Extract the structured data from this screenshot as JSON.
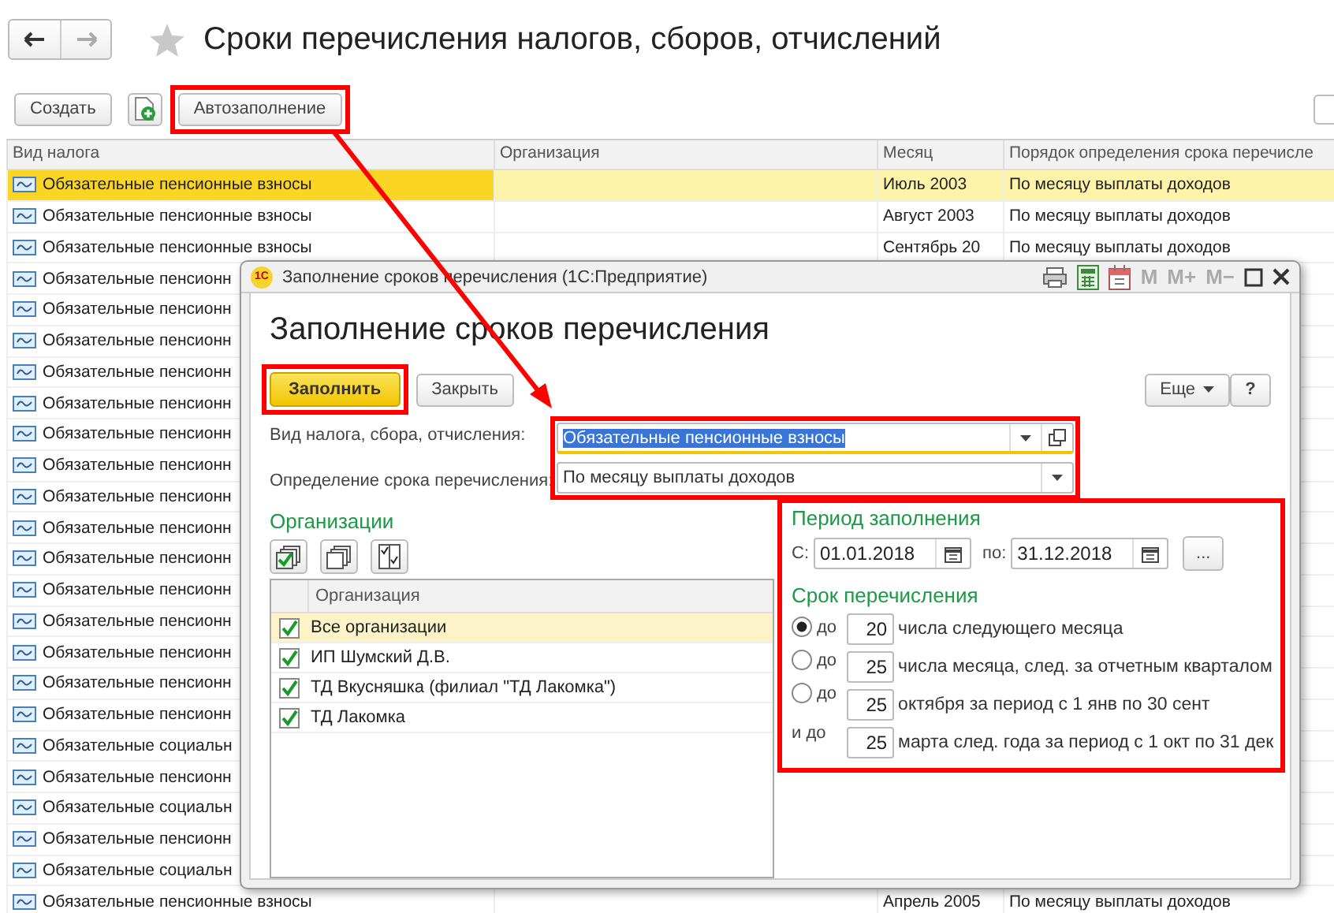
{
  "page_title": "Сроки перечисления налогов, сборов, отчислений",
  "toolbar": [
    {
      "kind": "text",
      "label": "Создать",
      "annotated": false
    },
    {
      "kind": "add-icon",
      "annotated": false
    },
    {
      "kind": "text",
      "label": "Автозаполнение",
      "annotated": true
    }
  ],
  "table": {
    "columns": [
      "Вид налога",
      "Организация",
      "Месяц",
      "Порядок определения срока перечисле"
    ],
    "rows": [
      {
        "tax": "Обязательные пенсионные взносы",
        "organization": "",
        "month": "Июль 2003",
        "order": "По месяцу выплаты доходов",
        "selected": true
      },
      {
        "tax": "Обязательные пенсионные взносы",
        "organization": "",
        "month": "Август 2003",
        "order": "По месяцу выплаты доходов",
        "selected": false
      },
      {
        "tax": "Обязательные пенсионные взносы",
        "organization": "",
        "month": "Сентябрь 20",
        "order": "По месяцу выплаты доходов",
        "selected": false
      },
      {
        "tax": "Обязательные пенсионн",
        "selected": false
      },
      {
        "tax": "Обязательные пенсионн",
        "selected": false
      },
      {
        "tax": "Обязательные пенсионн",
        "selected": false
      },
      {
        "tax": "Обязательные пенсионн",
        "selected": false
      },
      {
        "tax": "Обязательные пенсионн",
        "selected": false
      },
      {
        "tax": "Обязательные пенсионн",
        "selected": false
      },
      {
        "tax": "Обязательные пенсионн",
        "selected": false
      },
      {
        "tax": "Обязательные пенсионн",
        "selected": false
      },
      {
        "tax": "Обязательные пенсионн",
        "selected": false
      },
      {
        "tax": "Обязательные пенсионн",
        "selected": false
      },
      {
        "tax": "Обязательные пенсионн",
        "selected": false
      },
      {
        "tax": "Обязательные пенсионн",
        "selected": false
      },
      {
        "tax": "Обязательные пенсионн",
        "selected": false
      },
      {
        "tax": "Обязательные пенсионн",
        "selected": false
      },
      {
        "tax": "Обязательные пенсионн",
        "selected": false
      },
      {
        "tax": "Обязательные социальн",
        "selected": false
      },
      {
        "tax": "Обязательные пенсионн",
        "selected": false
      },
      {
        "tax": "Обязательные социальн",
        "selected": false
      },
      {
        "tax": "Обязательные пенсионн",
        "selected": false
      },
      {
        "tax": "Обязательные социальн",
        "selected": false
      },
      {
        "tax": "Обязательные пенсионные взносы",
        "organization": "",
        "month": "Апрель 2005",
        "order": "По месяцу выплаты доходов",
        "selected": false
      }
    ]
  },
  "dialog": {
    "window_title": "Заполнение сроков перечисления  (1С:Предприятие)",
    "logo": "1С",
    "memory_buttons": [
      "M",
      "M+",
      "M−"
    ],
    "heading": "Заполнение сроков перечисления",
    "buttons": [
      {
        "kind": "default",
        "label": "Заполнить",
        "annotated": true
      },
      {
        "kind": "plain",
        "label": "Закрыть",
        "annotated": false
      }
    ],
    "more_button": "Еще",
    "help_button": "?",
    "fields_annotated": true,
    "fields": [
      {
        "label": "Вид налога, сбора, отчисления:",
        "value": "Обязательные пенсионные взносы",
        "text_selected": true,
        "open_button": true
      },
      {
        "label": "Определение срока перечисления:",
        "value": "По месяцу выплаты доходов",
        "text_selected": false,
        "open_button": false
      }
    ],
    "organizations": {
      "title": "Организации",
      "column": "Организация",
      "rows": [
        {
          "name": "Все организации",
          "checked": true,
          "selected": true
        },
        {
          "name": "ИП Шумский Д.В.",
          "checked": true,
          "selected": false
        },
        {
          "name": "ТД Вкусняшка (филиал \"ТД Лакомка\")",
          "checked": true,
          "selected": false
        },
        {
          "name": "ТД Лакомка",
          "checked": true,
          "selected": false
        }
      ]
    },
    "settings_annotated": true,
    "period": {
      "title": "Период заполнения",
      "from_label": "С:",
      "from": "01.01.2018",
      "to_label": "по:",
      "to": "31.12.2018",
      "choose_button": "..."
    },
    "deadline": {
      "title": "Срок перечисления",
      "options": [
        {
          "kind": "radio",
          "label": "до",
          "selected": true
        },
        {
          "kind": "radio",
          "label": "до",
          "selected": false
        },
        {
          "kind": "radio",
          "label": "до",
          "selected": false
        },
        {
          "kind": "plain",
          "label": "и до"
        }
      ],
      "days": [
        {
          "value": "20",
          "text": "числа следующего месяца"
        },
        {
          "value": "25",
          "text": "числа месяца, след. за отчетным кварталом"
        },
        {
          "value": "25",
          "text": "октября за период с 1 янв по 30 сент"
        },
        {
          "value": "25",
          "text": "марта след. года за период с 1 окт по 31 дек"
        }
      ]
    }
  }
}
